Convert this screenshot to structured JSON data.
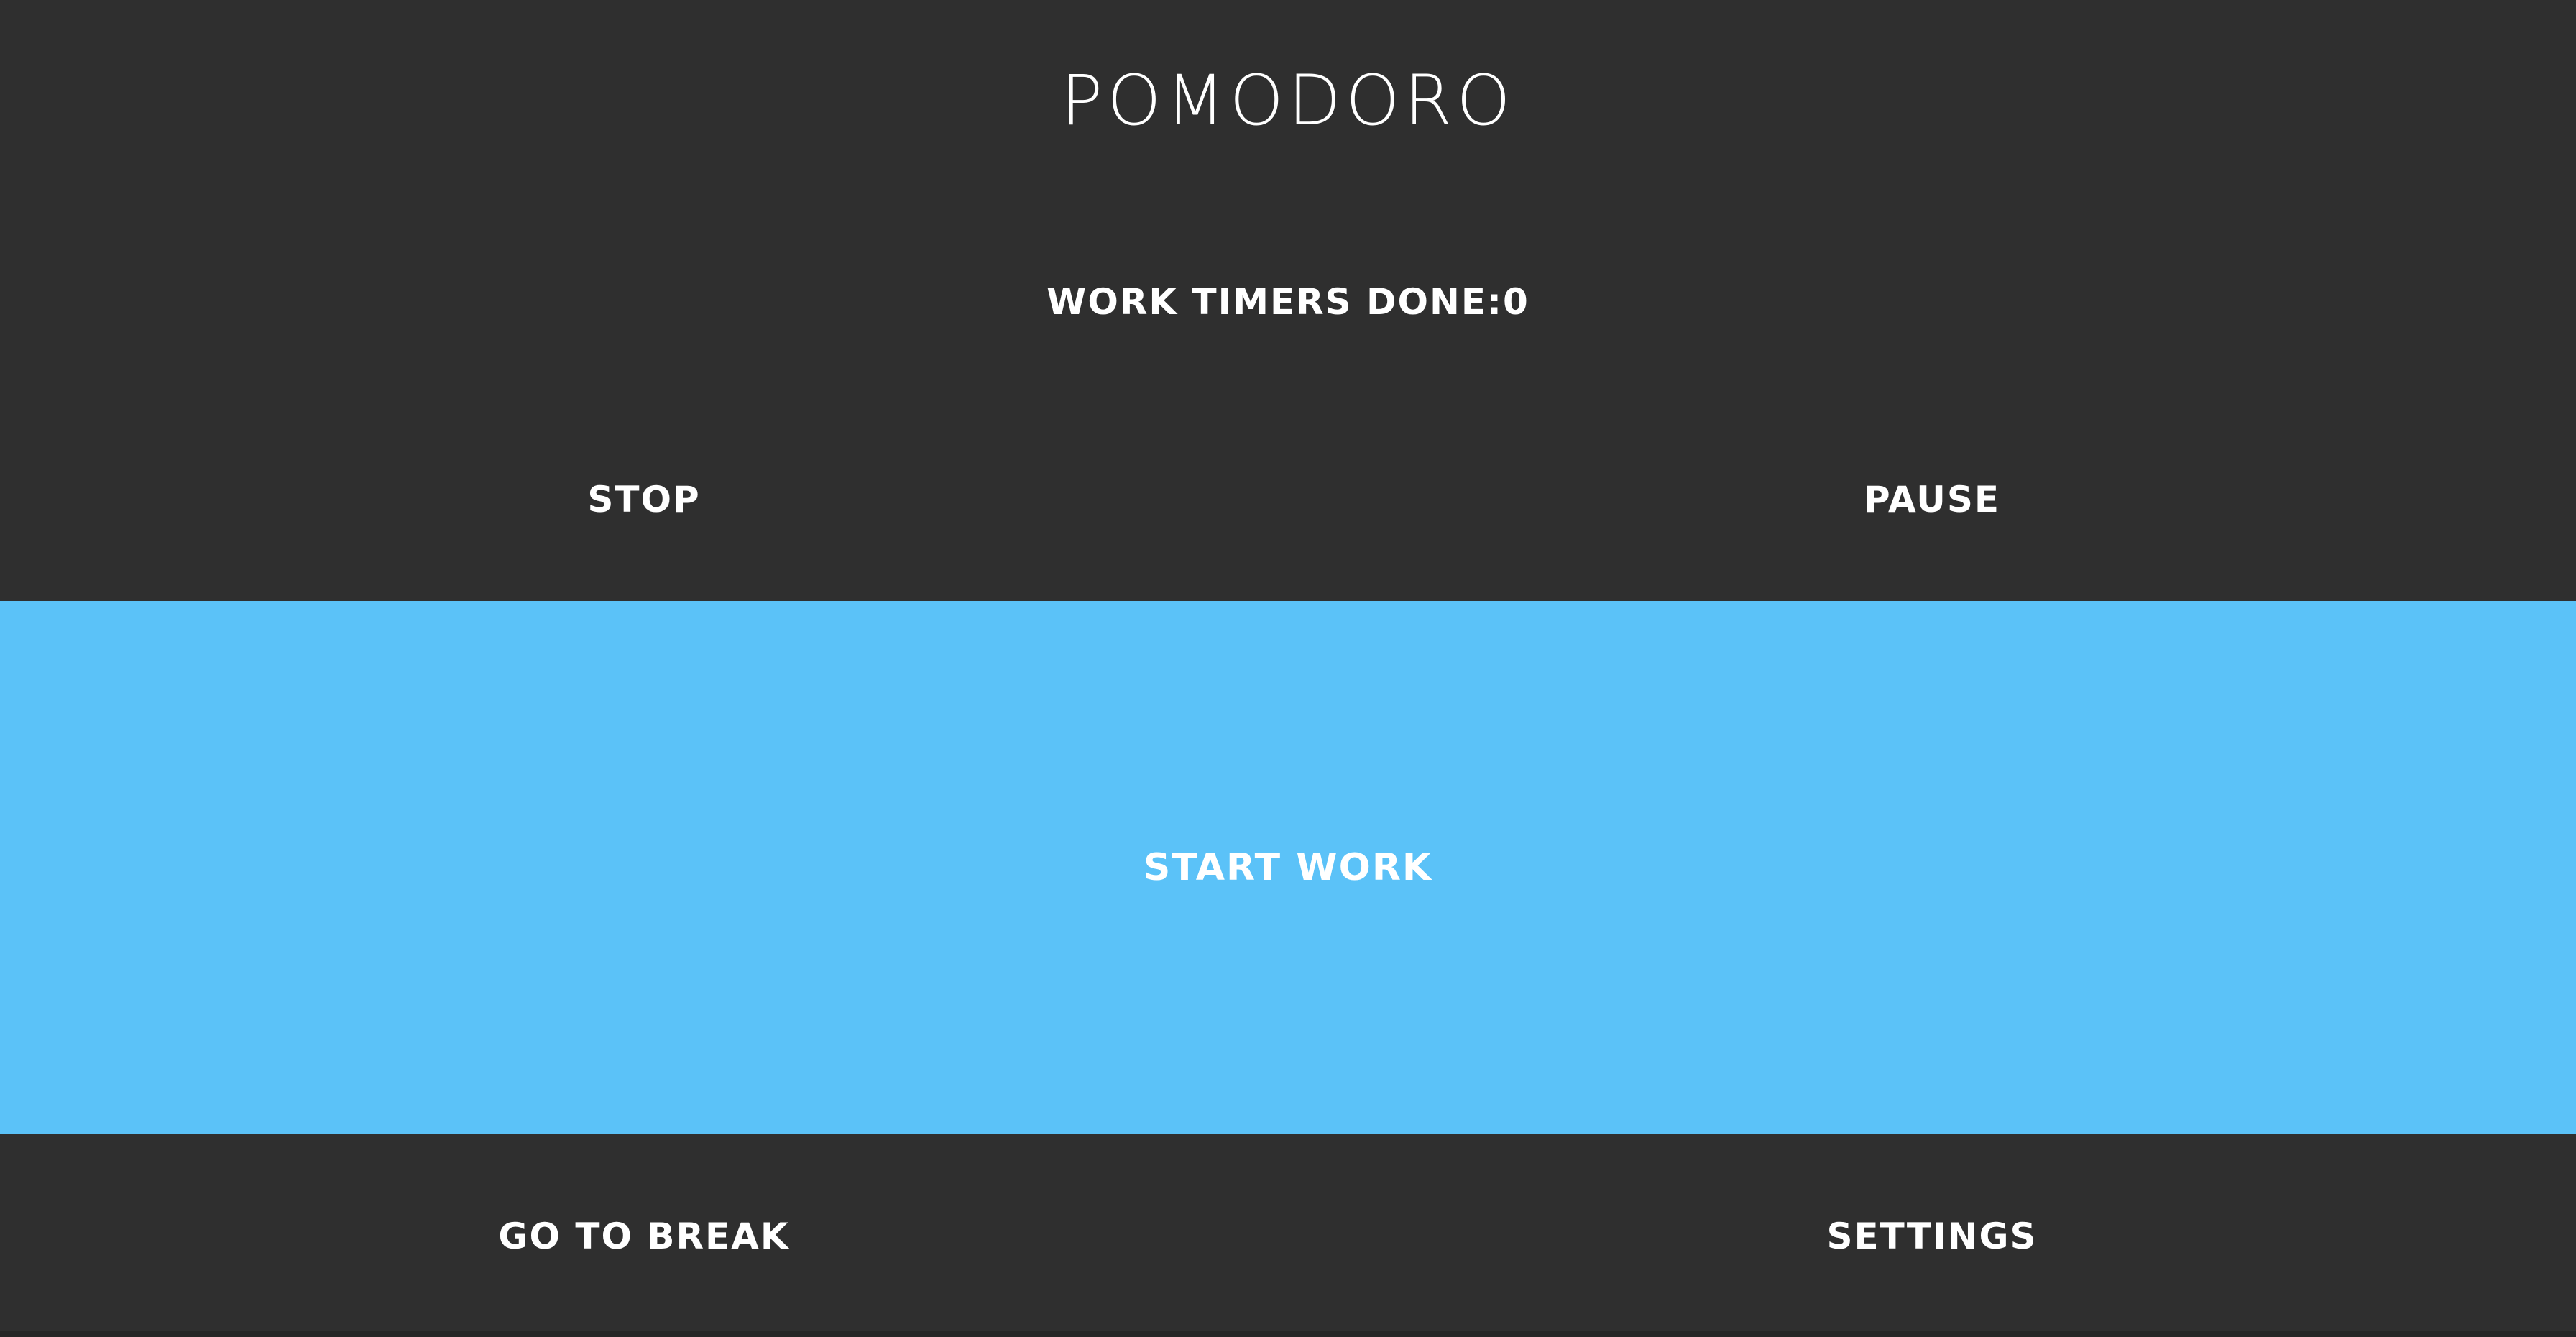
{
  "app": {
    "title": "POMODORO",
    "counter_text": "WORK TIMERS DONE:0"
  },
  "controls": {
    "stop_label": "STOP",
    "pause_label": "PAUSE",
    "start_label": "START WORK",
    "break_label": "GO TO BREAK",
    "settings_label": "SETTINGS"
  },
  "colors": {
    "background": "#2f2f2f",
    "accent": "#5bc2f8",
    "text": "#ffffff"
  }
}
